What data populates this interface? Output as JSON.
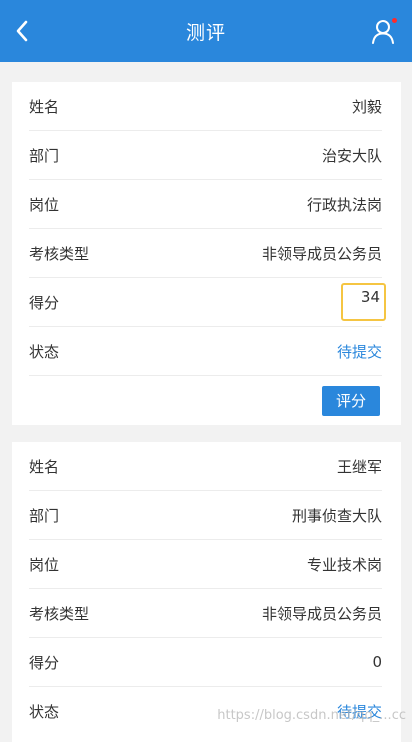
{
  "header": {
    "title": "测评",
    "back_icon": "chevron-left-icon",
    "user_icon": "user-icon",
    "colors": {
      "bar": "#2a87dc",
      "notification_dot": "#ff2a2a"
    }
  },
  "records": [
    {
      "name_label": "姓名",
      "name": "刘毅",
      "dept_label": "部门",
      "dept": "治安大队",
      "post_label": "岗位",
      "post": "行政执法岗",
      "type_label": "考核类型",
      "type": "非领导成员公务员",
      "score_label": "得分",
      "score": "34",
      "status_label": "状态",
      "status": "待提交",
      "button_label": "评分"
    },
    {
      "name_label": "姓名",
      "name": "王继军",
      "dept_label": "部门",
      "dept": "刑事侦查大队",
      "post_label": "岗位",
      "post": "专业技术岗",
      "type_label": "考核类型",
      "type": "非领导成员公务员",
      "score_label": "得分",
      "score": "0",
      "status_label": "状态",
      "status": "待提交"
    }
  ],
  "watermark": "https://blog.csdn.net/qq_...cc",
  "colors": {
    "accent": "#2a87dc",
    "input_focus_border": "#f5c542"
  }
}
